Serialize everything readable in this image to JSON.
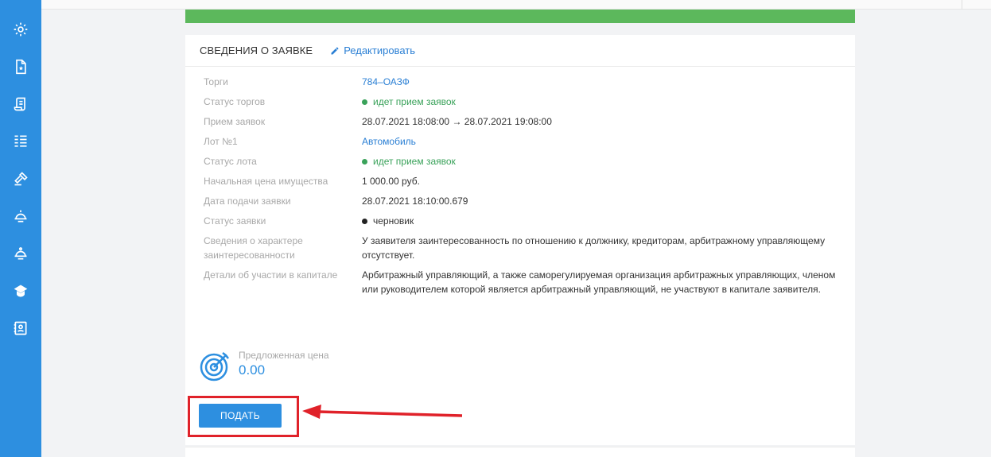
{
  "card": {
    "title": "СВЕДЕНИЯ О ЗАЯВКЕ",
    "edit_label": "Редактировать"
  },
  "rows": [
    {
      "label": "Торги",
      "value": "784–ОАЗФ"
    },
    {
      "label": "Статус торгов",
      "value": "идет прием заявок"
    },
    {
      "label": "Прием заявок",
      "value": "28.07.2021 18:08:00 → 28.07.2021 19:08:00"
    },
    {
      "label": "Лот №1",
      "value": "Автомобиль"
    },
    {
      "label": "Статус лота",
      "value": "идет прием заявок"
    },
    {
      "label": "Начальная цена имущества",
      "value": "1 000.00 руб."
    },
    {
      "label": "Дата подачи заявки",
      "value": "28.07.2021 18:10:00.679"
    },
    {
      "label": "Статус заявки",
      "value": "черновик"
    },
    {
      "label": "Сведения о характере заинтересованности",
      "value": "У заявителя заинтересованность по отношению к должнику, кредиторам, арбитражному управляющему отсутствует."
    },
    {
      "label": "Детали об участии в капитале",
      "value": "Арбитражный управляющий, а также саморегулируемая организация арбитражных управляющих, членом или руководителем которой является арбитражный управляющий, не участвуют в капитале заявителя."
    }
  ],
  "offer": {
    "label": "Предложенная цена",
    "value": "0.00"
  },
  "submit_label": "ПОДАТЬ",
  "colors": {
    "sidebar": "#2d8fe0",
    "accent": "#2d8fe0",
    "link": "#2a7fd4",
    "status_green": "#3aa25a",
    "highlight_red": "#e0222a",
    "banner_green": "#5cb85c"
  },
  "sidebar_icons": [
    "settings-icon",
    "document-icon",
    "scroll-icon",
    "list-icon",
    "gavel-icon",
    "bell-icon",
    "bell-outline-icon",
    "cap-icon",
    "contacts-icon"
  ]
}
